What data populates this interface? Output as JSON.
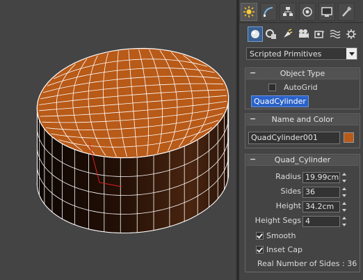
{
  "viewport": {
    "object_color": "#b85a18",
    "wire_color": "#ffffff"
  },
  "command_panel": {
    "tabs": [
      {
        "icon": "create-icon",
        "active": true
      },
      {
        "icon": "modify-icon"
      },
      {
        "icon": "hierarchy-icon"
      },
      {
        "icon": "motion-icon"
      },
      {
        "icon": "display-icon"
      },
      {
        "icon": "utilities-icon"
      }
    ],
    "subtabs": [
      {
        "icon": "geometry-icon",
        "active": true
      },
      {
        "icon": "shapes-icon"
      },
      {
        "icon": "lights-icon"
      },
      {
        "icon": "cameras-icon"
      },
      {
        "icon": "helpers-icon"
      },
      {
        "icon": "spacewarps-icon"
      },
      {
        "icon": "systems-icon"
      }
    ],
    "category": "Scripted Primitives",
    "object_type": {
      "title": "Object Type",
      "autogrid_label": "AutoGrid",
      "autogrid_checked": false,
      "button_label": "QuadCylinder"
    },
    "name_color": {
      "title": "Name and Color",
      "name": "QuadCylinder001",
      "color": "#b85a18"
    },
    "params": {
      "title": "Quad_Cylinder",
      "radius_label": "Radius",
      "radius": "19.99cm",
      "sides_label": "Sides",
      "sides": "36",
      "height_label": "Height",
      "height": "34.2cm",
      "height_segs_label": "Height Segs",
      "height_segs": "4",
      "smooth_label": "Smooth",
      "smooth_checked": true,
      "inset_cap_label": "Inset Cap",
      "inset_cap_checked": true,
      "real_sides_text": "Real Number of Sides : 36"
    }
  }
}
